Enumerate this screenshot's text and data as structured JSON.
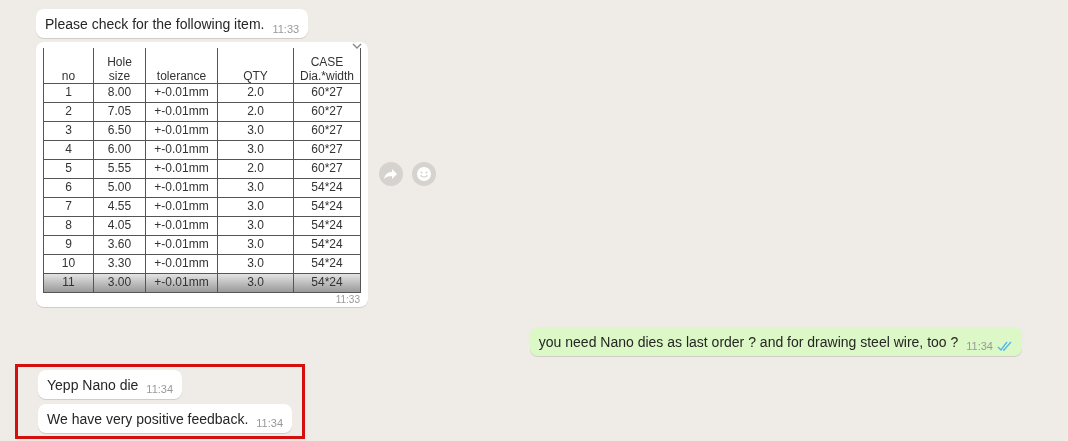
{
  "messages": [
    {
      "kind": "text",
      "outgoing": false,
      "text": "Please check for the following item.",
      "time": "11:33"
    },
    {
      "kind": "table",
      "outgoing": false,
      "time": "11:33",
      "table": {
        "columns": [
          "no",
          "Hole size",
          "tolerance",
          "QTY",
          "CASE Dia.*width"
        ],
        "rows": [
          [
            "1",
            "8.00",
            "+-0.01mm",
            "2.0",
            "60*27"
          ],
          [
            "2",
            "7.05",
            "+-0.01mm",
            "2.0",
            "60*27"
          ],
          [
            "3",
            "6.50",
            "+-0.01mm",
            "3.0",
            "60*27"
          ],
          [
            "4",
            "6.00",
            "+-0.01mm",
            "3.0",
            "60*27"
          ],
          [
            "5",
            "5.55",
            "+-0.01mm",
            "2.0",
            "60*27"
          ],
          [
            "6",
            "5.00",
            "+-0.01mm",
            "3.0",
            "54*24"
          ],
          [
            "7",
            "4.55",
            "+-0.01mm",
            "3.0",
            "54*24"
          ],
          [
            "8",
            "4.05",
            "+-0.01mm",
            "3.0",
            "54*24"
          ],
          [
            "9",
            "3.60",
            "+-0.01mm",
            "3.0",
            "54*24"
          ],
          [
            "10",
            "3.30",
            "+-0.01mm",
            "3.0",
            "54*24"
          ],
          [
            "11",
            "3.00",
            "+-0.01mm",
            "3.0",
            "54*24"
          ]
        ]
      }
    },
    {
      "kind": "text",
      "outgoing": true,
      "text": "you need Nano dies as last order ? and for drawing steel wire, too ?",
      "time": "11:34",
      "read": true
    },
    {
      "kind": "group",
      "highlighted": true,
      "messages": [
        {
          "kind": "text",
          "outgoing": false,
          "text": "Yepp Nano die",
          "time": "11:34"
        },
        {
          "kind": "text",
          "outgoing": false,
          "text": "We have very positive feedback.",
          "time": "11:34"
        }
      ]
    }
  ]
}
